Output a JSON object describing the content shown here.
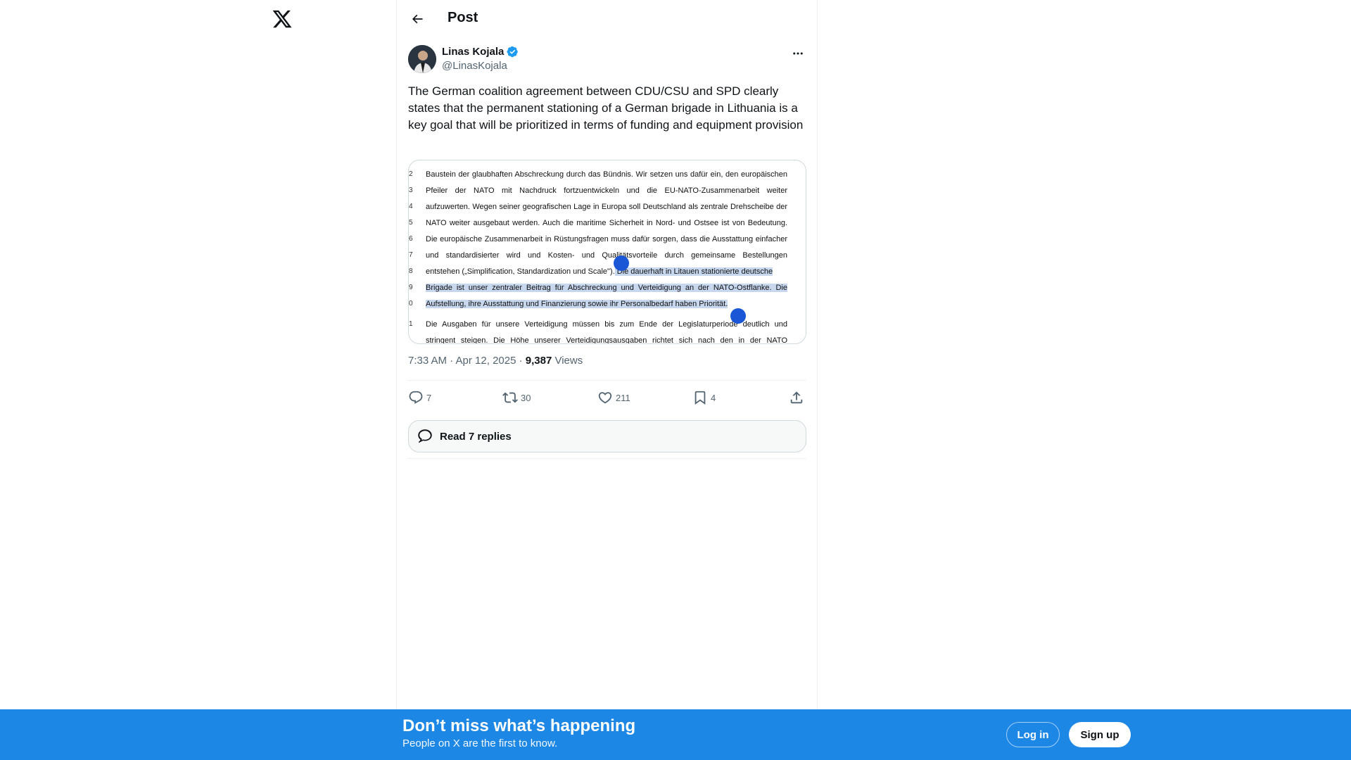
{
  "header": {
    "title": "Post"
  },
  "author": {
    "name": "Linas Kojala",
    "handle": "@LinasKojala"
  },
  "tweet": {
    "text": "The German coalition agreement between CDU/CSU and SPD clearly states that the permanent stationing of a German brigade in Lithuania is a key goal that will be prioritized in terms of funding and equipment provision"
  },
  "media": {
    "gutter": [
      "2",
      "3",
      "4",
      "5",
      "6",
      "7",
      "8",
      "9",
      "0",
      "1"
    ],
    "lines": [
      "Baustein der glaubhaften Abschreckung durch das Bündnis. Wir setzen uns dafür ein, den europäischen",
      "Pfeiler der NATO mit Nachdruck fortzuentwickeln und die EU-NATO-Zusammenarbeit weiter",
      "aufzuwerten. Wegen seiner geografischen Lage in Europa soll Deutschland als zentrale Drehscheibe der",
      "NATO weiter ausgebaut werden. Auch die maritime Sicherheit in Nord- und Ostsee ist von Bedeutung.",
      "Die europäische Zusammenarbeit in Rüstungsfragen muss dafür sorgen, dass die Ausstattung einfacher",
      "und standardisierter wird und Kosten- und Qualitätsvorteile durch gemeinsame Bestellungen"
    ],
    "line7_plain": "entstehen („Simplification, Standardization und Scale\").",
    "line7_hl": " Die dauerhaft in Litauen stationierte deutsche",
    "line8_hl": "Brigade ist unser zentraler Beitrag für Abschreckung und Verteidigung an der NATO-Ostflanke. Die",
    "line9_hl": "Aufstellung, ihre Ausstattung und Finanzierung sowie ihr Personalbedarf haben Priorität.",
    "line10": "Die Ausgaben für unsere Verteidigung müssen bis zum Ende der Legislaturperiode deutlich und",
    "line11": "stringent steigen. Die Höhe unserer Verteidigungsausgaben richtet sich nach den in der NATO"
  },
  "meta": {
    "time": "7:33 AM · Apr 12, 2025 · ",
    "views_count": "9,387",
    "views_label": " Views"
  },
  "actions": {
    "replies": "7",
    "reposts": "30",
    "likes": "211",
    "bookmarks": "4"
  },
  "read_replies": {
    "label": "Read 7 replies"
  },
  "footer": {
    "title": "Don’t miss what’s happening",
    "subtitle": "People on X are the first to know.",
    "login": "Log in",
    "signup": "Sign up"
  },
  "colors": {
    "accent": "#1d9bf0",
    "footer_bg": "#1d87e6",
    "handle": "#1a56d6"
  }
}
